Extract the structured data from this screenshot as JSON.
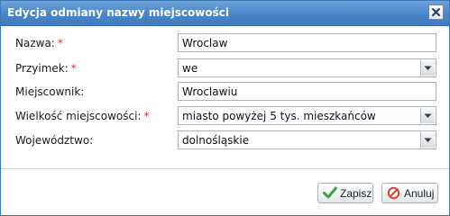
{
  "dialog": {
    "title": "Edycja odmiany nazwy miejscowości",
    "close_icon": "close-icon"
  },
  "form": {
    "fields": [
      {
        "label": "Nazwa:",
        "required": true,
        "type": "text",
        "value": "Wroclaw"
      },
      {
        "label": "Przyimek:",
        "required": true,
        "type": "select",
        "value": "we"
      },
      {
        "label": "Miejscownik:",
        "required": false,
        "type": "text",
        "value": "Wroclawiu"
      },
      {
        "label": "Wielkość miejscowości:",
        "required": true,
        "type": "select",
        "value": "miasto powyżej 5 tys. mieszkańców"
      },
      {
        "label": "Województwo:",
        "required": false,
        "type": "select",
        "value": "dolnośląskie"
      }
    ],
    "required_marker": "*"
  },
  "footer": {
    "save_label": "Zapisz",
    "save_icon": "checkmark-icon",
    "cancel_label": "Anuluj",
    "cancel_icon": "cancel-icon"
  },
  "colors": {
    "titlebar": "#4a86c6",
    "required": "#e0312e",
    "save_icon": "#3aa33a",
    "cancel_icon": "#d9452f"
  }
}
